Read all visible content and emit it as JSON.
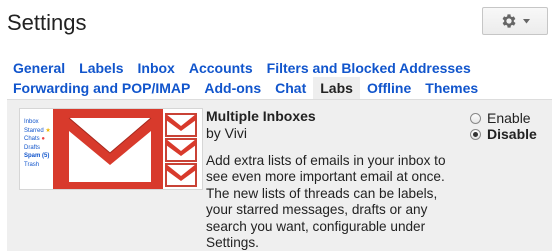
{
  "page": {
    "title": "Settings"
  },
  "toolbar": {
    "gear_icon": "gear-icon",
    "dropdown_icon": "chevron-down-icon"
  },
  "tabs": {
    "row1": [
      "General",
      "Labels",
      "Inbox",
      "Accounts",
      "Filters and Blocked Addresses"
    ],
    "row2": [
      "Forwarding and POP/IMAP",
      "Add-ons",
      "Chat",
      "Labs",
      "Offline",
      "Themes"
    ],
    "active": "Labs"
  },
  "lab": {
    "title": "Multiple Inboxes",
    "author": "by Vivi",
    "description": "Add extra lists of emails in your inbox to see even more important email at once. The new lists of threads can be labels, your starred messages, drafts or any search you want, configurable under Settings.",
    "thumbnail_items": [
      "Inbox",
      "Starred",
      "Chats",
      "Drafts",
      "Spam (5)",
      "Trash"
    ],
    "options": [
      {
        "label": "Enable",
        "selected": false
      },
      {
        "label": "Disable",
        "selected": true
      }
    ]
  },
  "colors": {
    "link": "#1155cc",
    "panel_bg": "#efefef",
    "gmail_red": "#d93025"
  }
}
